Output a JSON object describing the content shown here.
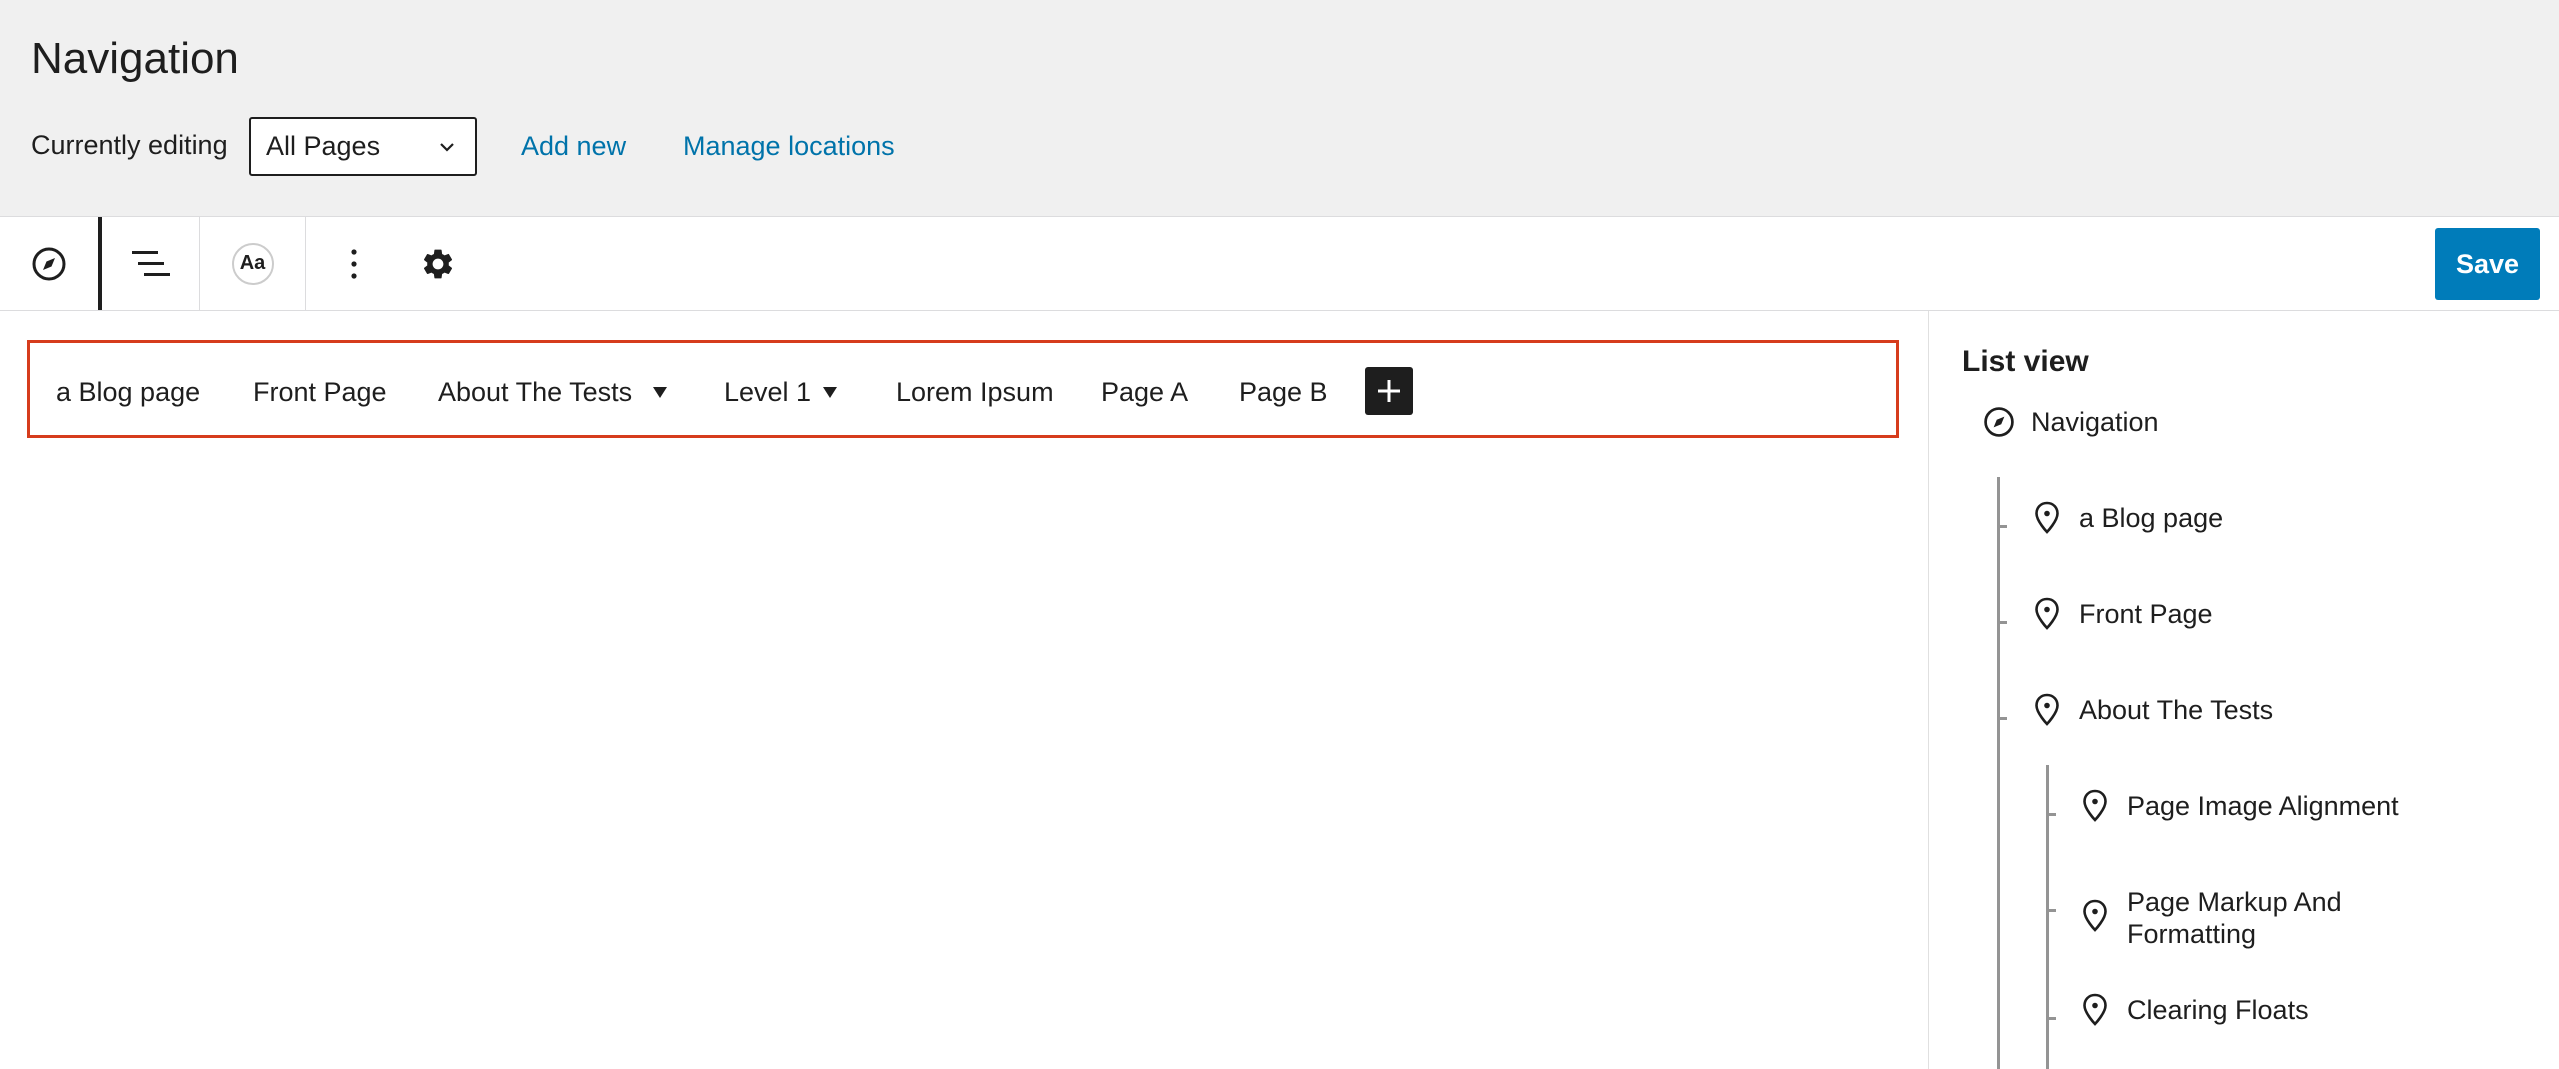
{
  "header": {
    "title": "Navigation",
    "editing_label": "Currently editing",
    "selected_menu": "All Pages",
    "add_new_label": "Add new",
    "manage_locations_label": "Manage locations"
  },
  "toolbar": {
    "icons": [
      "compass-icon",
      "list-view-icon",
      "typography-icon",
      "more-vertical-icon",
      "gear-icon"
    ],
    "typography_label": "Aa",
    "save_label": "Save"
  },
  "nav_block": {
    "items": [
      {
        "label": "a Blog page",
        "has_submenu": false
      },
      {
        "label": "Front Page",
        "has_submenu": false
      },
      {
        "label": "About The Tests",
        "has_submenu": true
      },
      {
        "label": "Level 1",
        "has_submenu": true
      },
      {
        "label": "Lorem Ipsum",
        "has_submenu": false
      },
      {
        "label": "Page A",
        "has_submenu": false
      },
      {
        "label": "Page B",
        "has_submenu": false
      }
    ]
  },
  "list_view": {
    "title": "List view",
    "root": {
      "label": "Navigation",
      "icon": "compass-icon"
    },
    "items": [
      {
        "label": "a Blog page",
        "icon": "map-marker-icon",
        "depth": 1
      },
      {
        "label": "Front Page",
        "icon": "map-marker-icon",
        "depth": 1
      },
      {
        "label": "About The Tests",
        "icon": "map-marker-icon",
        "depth": 1
      },
      {
        "label": "Page Image Alignment",
        "icon": "map-marker-icon",
        "depth": 2
      },
      {
        "label": "Page Markup And Formatting",
        "icon": "map-marker-icon",
        "depth": 2
      },
      {
        "label": "Clearing Floats",
        "icon": "map-marker-icon",
        "depth": 2
      }
    ]
  },
  "colors": {
    "accent": "#007cba",
    "link": "#0073aa",
    "block_border": "#d63c1c",
    "header_bg": "#f0f0f0"
  }
}
